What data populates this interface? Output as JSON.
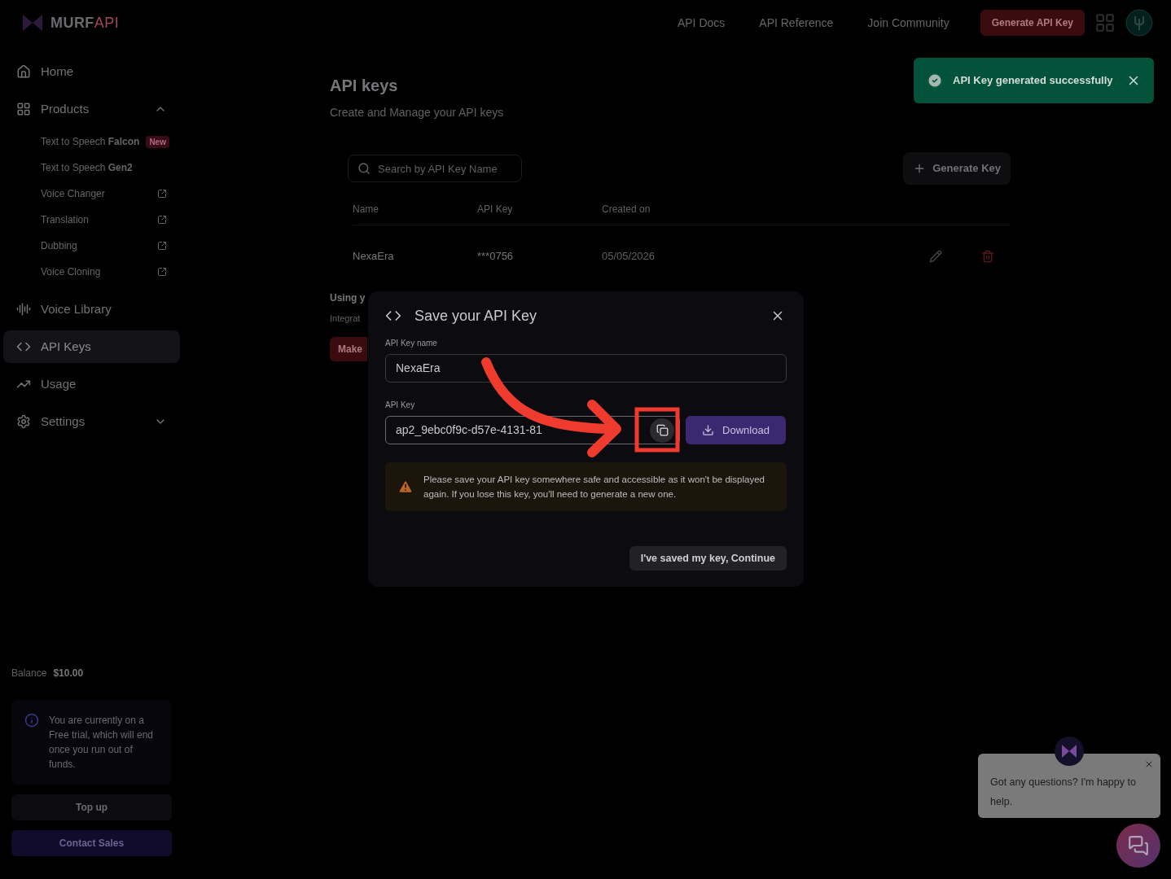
{
  "header": {
    "brand": "MURF",
    "brand_suffix": "API",
    "links": [
      "API Docs",
      "API Reference",
      "Join Community"
    ],
    "cta": "Generate API Key"
  },
  "sidebar": {
    "items": [
      {
        "label": "Home",
        "selected": false
      },
      {
        "label": "Products",
        "selected": false,
        "expanded": true,
        "children": [
          {
            "label": "Text to Speech **Falcon**",
            "badge": "New"
          },
          {
            "label": "Text to Speech **Gen2**"
          },
          {
            "label": "Voice Changer",
            "external": true
          },
          {
            "label": "Translation",
            "external": true
          },
          {
            "label": "Dubbing",
            "external": true
          },
          {
            "label": "Voice Cloning",
            "external": true
          }
        ]
      },
      {
        "label": "Voice Library",
        "selected": false
      },
      {
        "label": "API Keys",
        "selected": true
      },
      {
        "label": "Usage",
        "selected": false
      },
      {
        "label": "Settings",
        "selected": false,
        "expanded": false
      }
    ],
    "balance_label": "Balance",
    "balance_value": "$10.00",
    "notice": "You are currently on a Free trial, which will end once you run out of funds.",
    "top_up": "Top up",
    "contact": "Contact Sales"
  },
  "main": {
    "title": "API keys",
    "subtitle": "Create and Manage your API keys",
    "search": {
      "placeholder": "Search by API Key Name"
    },
    "generate": "Generate Key",
    "table": {
      "columns": [
        "Name",
        "API Key",
        "Created on"
      ],
      "rows": [
        {
          "name": "NexaEra",
          "key": "***0756",
          "created": "05/05/2026"
        }
      ]
    },
    "section_title": "Using y",
    "section_text": "Integrat",
    "section_button": "Make"
  },
  "toast": {
    "message": "API Key generated successfully"
  },
  "dialog": {
    "title": "Save your API Key",
    "name_label": "API Key name",
    "name_value": "NexaEra",
    "key_label": "API Key",
    "key_value": "ap2_9ebc0f9c-d57e-4131-81",
    "download": "Download",
    "warning": "Please save your API key somewhere safe and accessible as it won't be displayed again. If you lose this key, you'll need to generate a new one.",
    "continue": "I've saved my key, Continue"
  },
  "chat": {
    "message": "Got any questions? I'm happy to help."
  }
}
